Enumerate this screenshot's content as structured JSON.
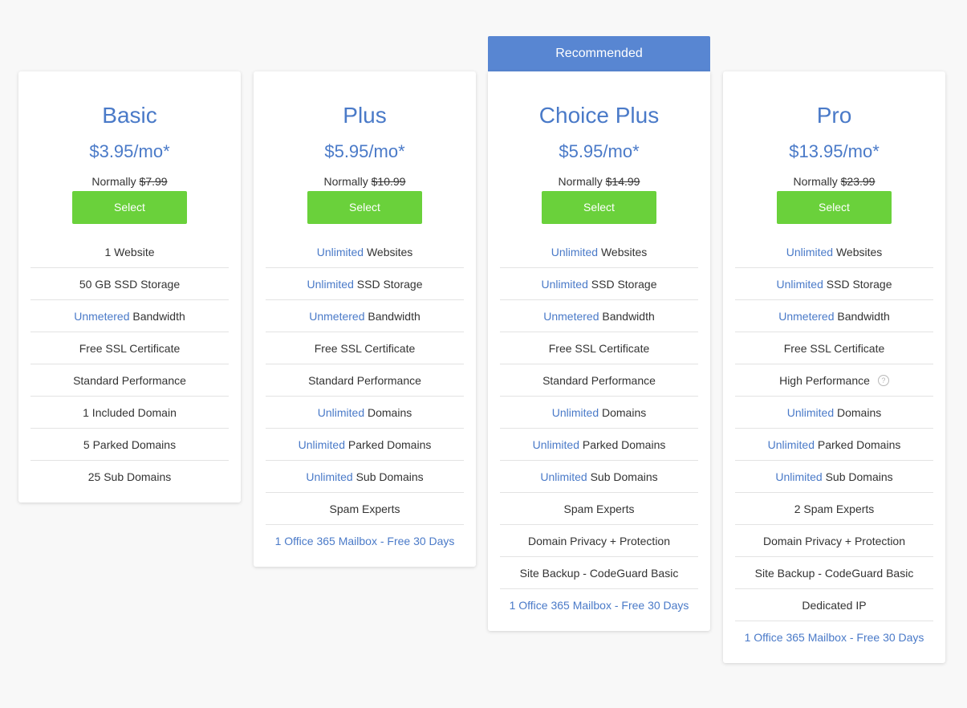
{
  "recommended_label": "Recommended",
  "colors": {
    "accent": "#4a7ac8",
    "ribbon": "#5886d2",
    "select_button": "#6ad13b",
    "background": "#f8f8f8"
  },
  "plans": [
    {
      "name": "Basic",
      "price": "$3.95/mo*",
      "normally_label": "Normally",
      "normally_price": "$7.99",
      "select_label": "Select",
      "features": [
        {
          "text": "1 Website"
        },
        {
          "text": "50 GB SSD Storage"
        },
        {
          "highlight": "Unmetered",
          "text": " Bandwidth"
        },
        {
          "text": "Free SSL Certificate"
        },
        {
          "text": "Standard Performance"
        },
        {
          "text": "1 Included Domain"
        },
        {
          "text": "5 Parked Domains"
        },
        {
          "text": "25 Sub Domains"
        }
      ]
    },
    {
      "name": "Plus",
      "price": "$5.95/mo*",
      "normally_label": "Normally",
      "normally_price": "$10.99",
      "select_label": "Select",
      "features": [
        {
          "highlight": "Unlimited",
          "text": " Websites"
        },
        {
          "highlight": "Unlimited",
          "text": " SSD Storage"
        },
        {
          "highlight": "Unmetered",
          "text": " Bandwidth"
        },
        {
          "text": "Free SSL Certificate"
        },
        {
          "text": "Standard Performance"
        },
        {
          "highlight": "Unlimited",
          "text": " Domains"
        },
        {
          "highlight": "Unlimited",
          "text": " Parked Domains"
        },
        {
          "highlight": "Unlimited",
          "text": " Sub Domains"
        },
        {
          "text": "Spam Experts"
        },
        {
          "link": "1 Office 365 Mailbox - Free 30 Days"
        }
      ]
    },
    {
      "name": "Choice Plus",
      "price": "$5.95/mo*",
      "normally_label": "Normally",
      "normally_price": "$14.99",
      "select_label": "Select",
      "features": [
        {
          "highlight": "Unlimited",
          "text": " Websites"
        },
        {
          "highlight": "Unlimited",
          "text": " SSD Storage"
        },
        {
          "highlight": "Unmetered",
          "text": " Bandwidth"
        },
        {
          "text": "Free SSL Certificate"
        },
        {
          "text": "Standard Performance"
        },
        {
          "highlight": "Unlimited",
          "text": " Domains"
        },
        {
          "highlight": "Unlimited",
          "text": " Parked Domains"
        },
        {
          "highlight": "Unlimited",
          "text": " Sub Domains"
        },
        {
          "text": "Spam Experts"
        },
        {
          "text": "Domain Privacy + Protection"
        },
        {
          "text": "Site Backup - CodeGuard Basic"
        },
        {
          "link": "1 Office 365 Mailbox - Free 30 Days"
        }
      ]
    },
    {
      "name": "Pro",
      "price": "$13.95/mo*",
      "normally_label": "Normally",
      "normally_price": "$23.99",
      "select_label": "Select",
      "features": [
        {
          "highlight": "Unlimited",
          "text": " Websites"
        },
        {
          "highlight": "Unlimited",
          "text": " SSD Storage"
        },
        {
          "highlight": "Unmetered",
          "text": " Bandwidth"
        },
        {
          "text": "Free SSL Certificate"
        },
        {
          "text": "High Performance",
          "help": "?"
        },
        {
          "highlight": "Unlimited",
          "text": " Domains"
        },
        {
          "highlight": "Unlimited",
          "text": " Parked Domains"
        },
        {
          "highlight": "Unlimited",
          "text": " Sub Domains"
        },
        {
          "text": "2 Spam Experts"
        },
        {
          "text": "Domain Privacy + Protection"
        },
        {
          "text": "Site Backup - CodeGuard Basic"
        },
        {
          "text": "Dedicated IP"
        },
        {
          "link": "1 Office 365 Mailbox - Free 30 Days"
        }
      ]
    }
  ]
}
